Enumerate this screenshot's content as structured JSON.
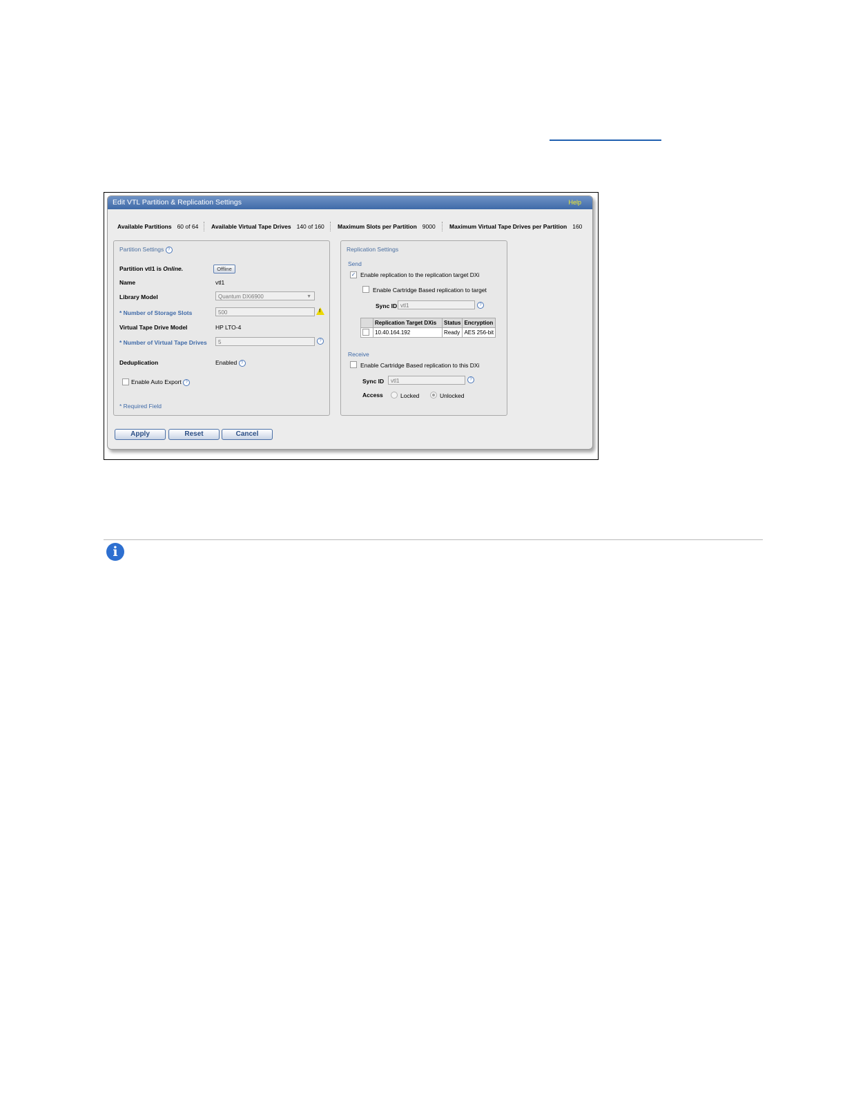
{
  "dialog": {
    "title": "Edit VTL Partition & Replication Settings",
    "help": "Help"
  },
  "stats": [
    {
      "label": "Available Partitions",
      "value": "60 of 64"
    },
    {
      "label": "Available Virtual Tape Drives",
      "value": "140 of 160"
    },
    {
      "label": "Maximum Slots per Partition",
      "value": "9000"
    },
    {
      "label": "Maximum Virtual Tape Drives per Partition",
      "value": "160"
    }
  ],
  "partition": {
    "title": "Partition Settings",
    "status_prefix": "Partition vtl1 is ",
    "status_value": "Online.",
    "offline_button": "Offline",
    "name_label": "Name",
    "name_value": "vtl1",
    "library_label": "Library Model",
    "library_value": "Quantum DXi6900",
    "slots_label": "* Number of Storage Slots",
    "slots_value": "500",
    "drive_model_label": "Virtual Tape Drive Model",
    "drive_model_value": "HP LTO-4",
    "drives_label": "* Number of Virtual Tape Drives",
    "drives_value": "5",
    "dedup_label": "Deduplication",
    "dedup_value": "Enabled",
    "auto_export_label": "Enable Auto Export",
    "required_note": "* Required Field"
  },
  "replication": {
    "title": "Replication Settings",
    "send_label": "Send",
    "enable_replication_label": "Enable replication to the replication target DXi",
    "enable_replication_checked": true,
    "enable_cartridge_label": "Enable Cartridge Based replication to target",
    "sync_id_label": "Sync ID",
    "sync_id_value": "vtl1",
    "table_headers": [
      "Replication Target DXis",
      "Status",
      "Encryption"
    ],
    "table_rows": [
      {
        "target": "10.40.164.192",
        "status": "Ready",
        "encryption": "AES 256-bit"
      }
    ],
    "receive_label": "Receive",
    "enable_receive_label": "Enable Cartridge Based replication to this DXi",
    "receive_sync_id_label": "Sync ID",
    "receive_sync_id_value": "vtl1",
    "access_label": "Access",
    "access_locked": "Locked",
    "access_unlocked": "Unlocked",
    "access_selected": "Unlocked"
  },
  "buttons": {
    "apply": "Apply",
    "reset": "Reset",
    "cancel": "Cancel"
  },
  "note_icon": "info-icon",
  "colors": {
    "title_bar": "#4f78b4",
    "help_text": "#f3ea2a",
    "link_line": "#1f5fb0",
    "info_icon": "#2d6fd0",
    "warning": "#ecd800"
  }
}
